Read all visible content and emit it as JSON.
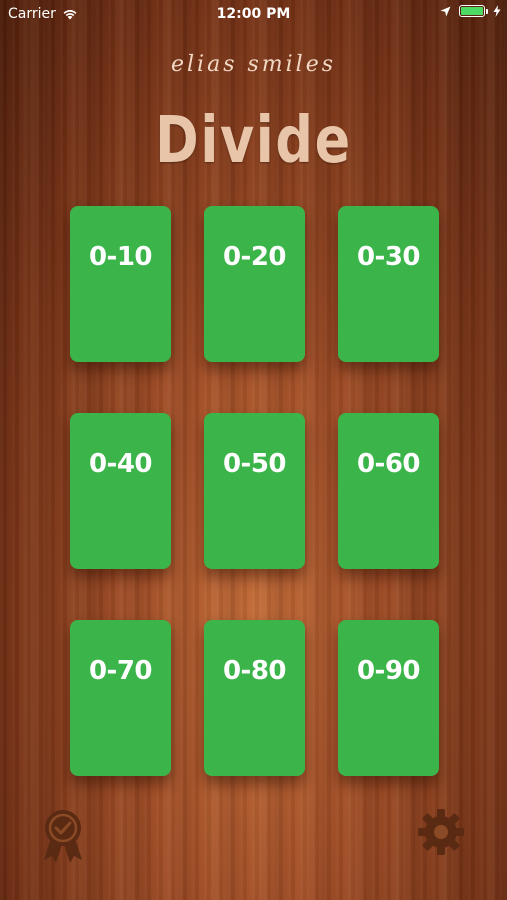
{
  "status_bar": {
    "carrier": "Carrier",
    "time": "12:00 PM",
    "battery_color": "#4cd964"
  },
  "header": {
    "brand": "elias smiles",
    "title": "Divide"
  },
  "colors": {
    "card": "#3bb54a",
    "title": "#e8c4a8",
    "icons": "#5a2a12"
  },
  "ranges": [
    {
      "label": "0-10"
    },
    {
      "label": "0-20"
    },
    {
      "label": "0-30"
    },
    {
      "label": "0-40"
    },
    {
      "label": "0-50"
    },
    {
      "label": "0-60"
    },
    {
      "label": "0-70"
    },
    {
      "label": "0-80"
    },
    {
      "label": "0-90"
    }
  ],
  "footer": {
    "left_icon": "award-ribbon-icon",
    "right_icon": "gear-icon"
  }
}
